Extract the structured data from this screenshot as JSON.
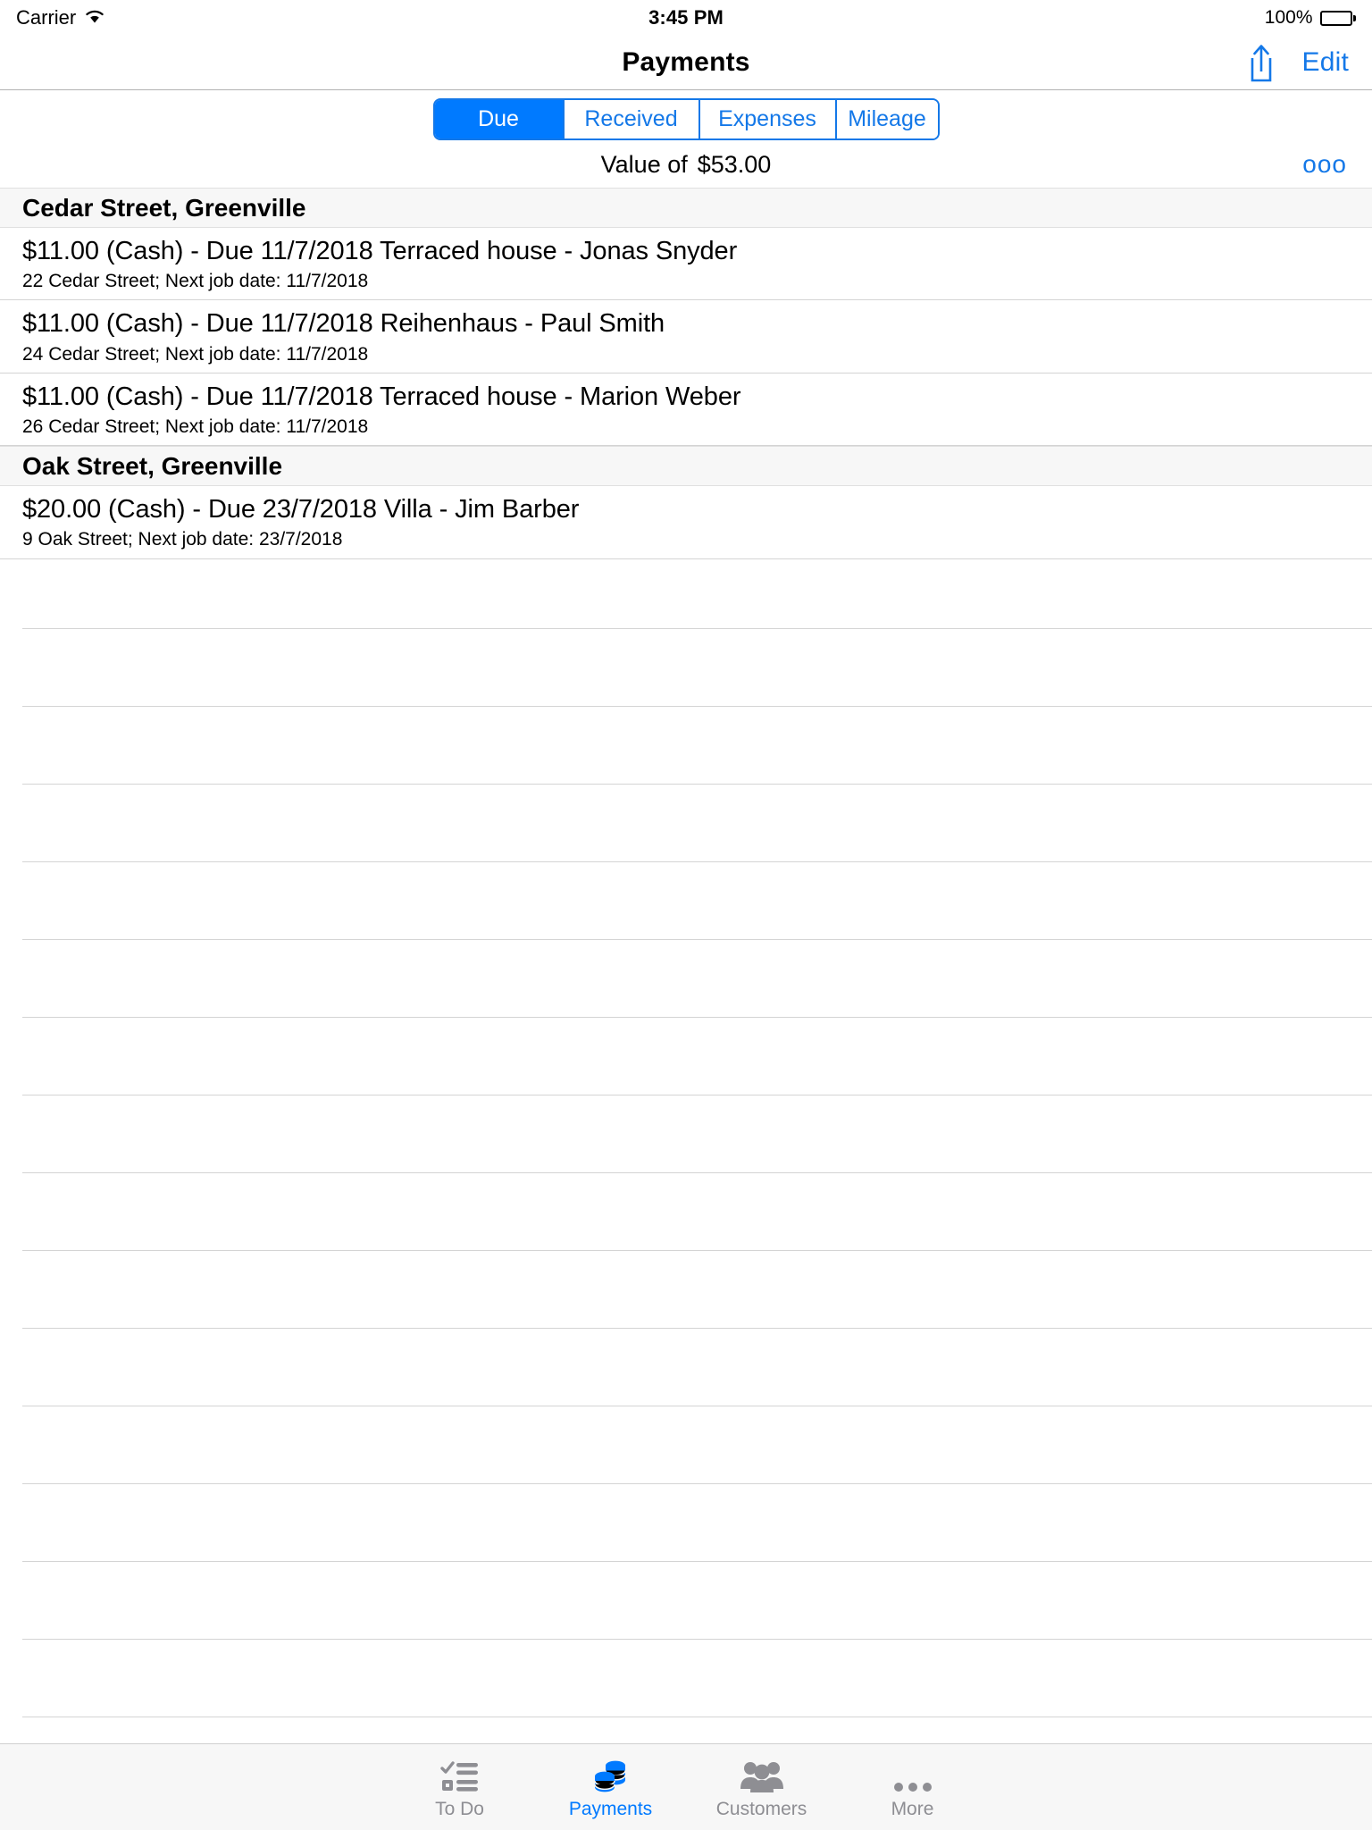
{
  "status_bar": {
    "carrier": "Carrier",
    "wifi_icon": "wifi-icon",
    "time": "3:45 PM",
    "battery_percent": "100%",
    "battery_icon": "battery-full-icon"
  },
  "nav_bar": {
    "title": "Payments",
    "share_icon": "share-icon",
    "edit_label": "Edit"
  },
  "segmented_control": {
    "selected": "Due",
    "segments": [
      {
        "label": "Due",
        "selected": true
      },
      {
        "label": "Received",
        "selected": false
      },
      {
        "label": "Expenses",
        "selected": false
      },
      {
        "label": "Mileage",
        "selected": false
      }
    ]
  },
  "summary": {
    "value_label": "Value of",
    "value_amount": "$53.00",
    "more_button": "ooo"
  },
  "list": {
    "sections": [
      {
        "header": "Cedar Street, Greenville",
        "rows": [
          {
            "title": "$11.00 (Cash) - Due 11/7/2018 Terraced house - Jonas Snyder",
            "subtitle": "22 Cedar Street; Next job date: 11/7/2018"
          },
          {
            "title": "$11.00 (Cash) - Due 11/7/2018 Reihenhaus - Paul Smith",
            "subtitle": "24 Cedar Street; Next job date: 11/7/2018"
          },
          {
            "title": "$11.00 (Cash) - Due 11/7/2018 Terraced house - Marion Weber",
            "subtitle": "26 Cedar Street; Next job date: 11/7/2018"
          }
        ]
      },
      {
        "header": "Oak Street, Greenville",
        "rows": [
          {
            "title": "$20.00 (Cash) - Due 23/7/2018 Villa - Jim Barber",
            "subtitle": "9 Oak Street; Next job date: 23/7/2018"
          }
        ]
      }
    ],
    "empty_row_count": 15
  },
  "tab_bar": {
    "tabs": [
      {
        "label": "To Do",
        "icon": "checklist-icon",
        "active": false
      },
      {
        "label": "Payments",
        "icon": "coins-icon",
        "active": true
      },
      {
        "label": "Customers",
        "icon": "people-icon",
        "active": false
      },
      {
        "label": "More",
        "icon": "ellipsis-icon",
        "active": false
      }
    ]
  },
  "colors": {
    "accent": "#007aff",
    "link": "#1478e8",
    "inactive_tab": "#8e8e93",
    "section_header_bg": "#f7f7f7",
    "separator": "#d4d4d4"
  }
}
